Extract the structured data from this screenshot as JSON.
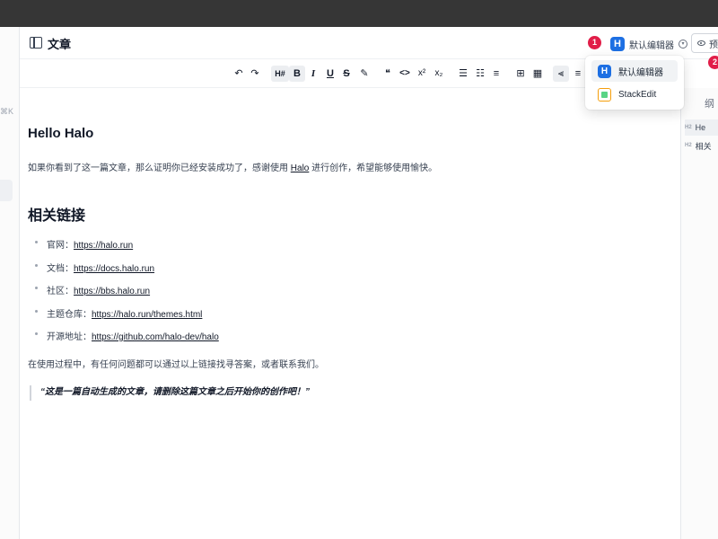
{
  "left_rail": {
    "shortcut": "⌘K",
    "more": "···"
  },
  "header": {
    "title": "文章",
    "current_editor": "默认编辑器",
    "preview_label": "预"
  },
  "badges": {
    "one": "1",
    "two": "2"
  },
  "toolbar": {
    "buttons": [
      {
        "name": "undo-button",
        "glyph": "↶"
      },
      {
        "name": "redo-button",
        "glyph": "↷"
      },
      {
        "name": "heading-button",
        "glyph": "H#"
      },
      {
        "name": "bold-button",
        "glyph": "B"
      },
      {
        "name": "italic-button",
        "glyph": "I"
      },
      {
        "name": "underline-button",
        "glyph": "U"
      },
      {
        "name": "strikethrough-button",
        "glyph": "S"
      },
      {
        "name": "highlight-button",
        "glyph": "✎"
      },
      {
        "name": "quote-button",
        "glyph": "❝"
      },
      {
        "name": "code-button",
        "glyph": "<>"
      },
      {
        "name": "superscript-button",
        "glyph": "x²"
      },
      {
        "name": "subscript-button",
        "glyph": "x₂"
      },
      {
        "name": "bullet-list-button",
        "glyph": "☰"
      },
      {
        "name": "ordered-list-button",
        "glyph": "☷"
      },
      {
        "name": "task-list-button",
        "glyph": "≡"
      },
      {
        "name": "code-block-button",
        "glyph": "⊞"
      },
      {
        "name": "table-button",
        "glyph": "▦"
      },
      {
        "name": "align-left-button",
        "glyph": "⫷"
      },
      {
        "name": "align-center-button",
        "glyph": "≡"
      }
    ]
  },
  "dropdown": {
    "items": [
      {
        "label": "默认编辑器"
      },
      {
        "label": "StackEdit"
      }
    ]
  },
  "outline": {
    "title": "纲",
    "items": [
      {
        "level": "H2",
        "label": "He"
      },
      {
        "level": "H2",
        "label": "相关"
      }
    ]
  },
  "content": {
    "title": "Hello Halo",
    "intro": {
      "before": "如果你看到了这一篇文章，那么证明你已经安装成功了，感谢使用 ",
      "link": "Halo",
      "after": " 进行创作，希望能够使用愉快。"
    },
    "section_title": "相关链接",
    "links": [
      {
        "label": "官网：",
        "url": "https://halo.run"
      },
      {
        "label": "文档：",
        "url": "https://docs.halo.run"
      },
      {
        "label": "社区：",
        "url": "https://bbs.halo.run"
      },
      {
        "label": "主题仓库：",
        "url": "https://halo.run/themes.html"
      },
      {
        "label": "开源地址：",
        "url": "https://github.com/halo-dev/halo"
      }
    ],
    "help_text": "在使用过程中，有任何问题都可以通过以上链接找寻答案，或者联系我们。",
    "quote": "“这是一篇自动生成的文章，请删除这篇文章之后开始你的创作吧！”"
  },
  "colors": {
    "brand_blue": "#1d6fe3",
    "badge_red": "#e11d48",
    "topbar": "#363636"
  }
}
